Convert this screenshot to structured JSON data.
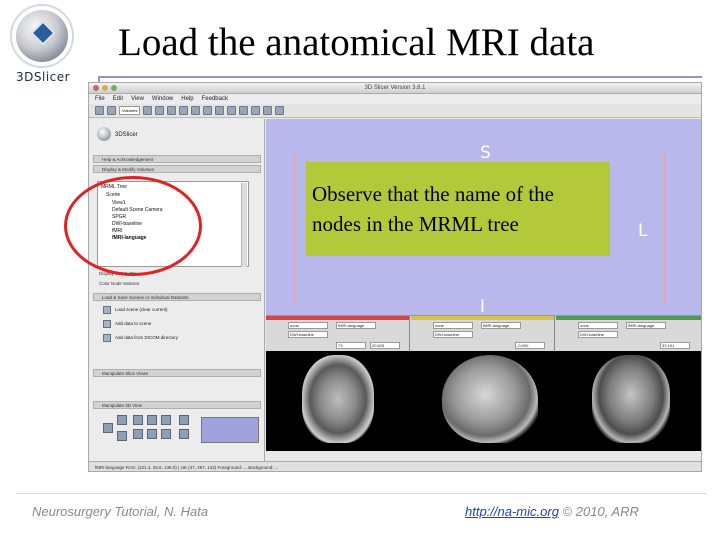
{
  "slide": {
    "title": "Load the anatomical MRI data",
    "logo_text": "3DSlicer",
    "footer_left": "Neurosurgery Tutorial, N. Hata",
    "footer_link": "http://na-mic.org",
    "footer_suffix": " © 2010, ARR"
  },
  "app": {
    "window_title": "3D Slicer Version 3.6.1",
    "menu": [
      "File",
      "Edit",
      "View",
      "Window",
      "Help",
      "Feedback"
    ],
    "toolbar_combo": "Volumes",
    "panel": {
      "logo_text": "3DSlicer",
      "sections": {
        "help": "Help & Acknowledgement",
        "volumes": "Display & Modify Volumes",
        "load_save": "Load & Save Scenes or Individual Datasets",
        "manip": "Manipulate Slice Views",
        "manip3d": "Manipulate 3D View"
      },
      "mrml_label": "MRML Tree",
      "mrml_nodes": [
        "Scene",
        "View1",
        "Default Scene Camera",
        "SPGR",
        "DWI-baseline",
        "fMRI",
        "fMRI-language"
      ],
      "display_checkbox": "Display MRML IDs",
      "color_combo": "Color Node Selector",
      "modules": [
        "Load scene (clear current)",
        "Add data to scene",
        "Add data from DICOM directory"
      ]
    },
    "view3d": {
      "orientation": {
        "superior": "S",
        "left": "L",
        "inferior": "I"
      }
    },
    "slice_bars": [
      {
        "color": "#d64545",
        "field_a": "none",
        "field_b": "DWI-baseline",
        "field_c": "fMRI-language",
        "value": "73",
        "offset": "20.625"
      },
      {
        "color": "#d6c244",
        "field_a": "none",
        "field_b": "DWI-baseline",
        "field_c": "fMRI-language",
        "value": "",
        "offset": "-0.000"
      },
      {
        "color": "#4f9a4f",
        "field_a": "none",
        "field_b": "DWI-baseline",
        "field_c": "fMRI-language",
        "value": "",
        "offset": "33.191"
      }
    ],
    "status_text": "fMRI-language RAS: (121.4, 34.6, 136.0) | IJK (47, 267, 142) Foreground: ... Background: ..."
  },
  "annotation": {
    "callout_line1": "Observe that the name of the",
    "callout_line2": "nodes in the MRML tree",
    "callout_color": "#b4c93a",
    "highlight_color": "#e02222"
  }
}
